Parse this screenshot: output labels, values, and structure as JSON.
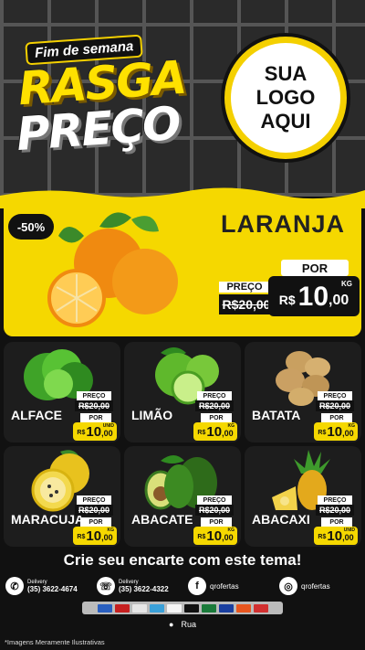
{
  "header": {
    "promo_subtitle": "Fim de semana",
    "promo_line1": "RASGA",
    "promo_line2": "PREÇO",
    "logo_lines": [
      "SUA",
      "LOGO",
      "AQUI"
    ]
  },
  "hero": {
    "discount_badge": "-50%",
    "product_name": "LARANJA",
    "old_price_label": "PREÇO",
    "old_price": "R$20,00",
    "new_price_label": "POR",
    "currency": "R$",
    "price_int": "10",
    "price_dec": ",00",
    "unit": "KG"
  },
  "products": [
    {
      "name": "ALFACE",
      "old_label": "PREÇO",
      "old_price": "R$20,00",
      "por": "POR",
      "currency": "R$",
      "price_int": "10",
      "price_dec": ",00",
      "unit": "UNID"
    },
    {
      "name": "LIMÃO",
      "old_label": "PREÇO",
      "old_price": "R$20,00",
      "por": "POR",
      "currency": "R$",
      "price_int": "10",
      "price_dec": ",00",
      "unit": "KG"
    },
    {
      "name": "BATATA",
      "old_label": "PREÇO",
      "old_price": "R$20,00",
      "por": "POR",
      "currency": "R$",
      "price_int": "10",
      "price_dec": ",00",
      "unit": "KG"
    },
    {
      "name": "MARACUJÁ",
      "old_label": "PREÇO",
      "old_price": "R$20,00",
      "por": "POR",
      "currency": "R$",
      "price_int": "10",
      "price_dec": ",00",
      "unit": "KG"
    },
    {
      "name": "ABACATE",
      "old_label": "PREÇO",
      "old_price": "R$20,00",
      "por": "POR",
      "currency": "R$",
      "price_int": "10",
      "price_dec": ",00",
      "unit": "KG"
    },
    {
      "name": "ABACAXI",
      "old_label": "PREÇO",
      "old_price": "R$20,00",
      "por": "POR",
      "currency": "R$",
      "price_int": "10",
      "price_dec": ",00",
      "unit": "UNID"
    }
  ],
  "footer": {
    "cta": "Crie seu encarte com este tema!",
    "whatsapp_label": "Delivery",
    "whatsapp_number": "(35) 3622-4674",
    "phone_label": "Delivery",
    "phone_number": "(35) 3622-4322",
    "facebook": "qrofertas",
    "instagram": "qrofertas",
    "address": "Rua",
    "disclaimer": "*Imagens Meramente Ilustrativas"
  },
  "colors": {
    "accent_yellow": "#f5d800",
    "background": "#111111",
    "card": "#1d1d1d"
  },
  "icons": [
    "whatsapp-icon",
    "phone-icon",
    "facebook-icon",
    "instagram-icon",
    "location-pin-icon"
  ]
}
